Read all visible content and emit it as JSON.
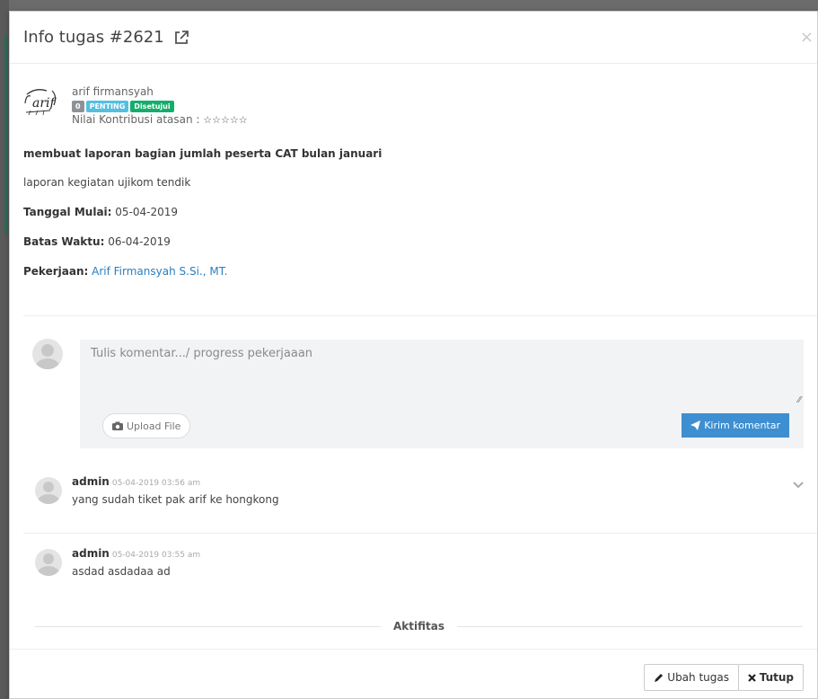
{
  "modal": {
    "title": "Info tugas #2621",
    "close_symbol": "×"
  },
  "author": {
    "name": "arif firmansyah",
    "signature_text": "arif",
    "badge_count": "0",
    "badge_priority": "PENTING",
    "badge_status": "Disetujui",
    "rating_label": "Nilai Kontribusi atasan :",
    "rating_stars": "☆☆☆☆☆"
  },
  "task": {
    "title": "membuat laporan bagian jumlah peserta CAT bulan januari",
    "description": "laporan kegiatan ujikom tendik",
    "start_label": "Tanggal Mulai:",
    "start_value": "05-04-2019",
    "deadline_label": "Batas Waktu:",
    "deadline_value": "06-04-2019",
    "assignee_label": "Pekerjaan:",
    "assignee_value": "Arif Firmansyah S.Si., MT."
  },
  "comment_form": {
    "placeholder": "Tulis komentar.../ progress pekerjaaan",
    "upload_label": "Upload File",
    "send_label": "Kirim komentar"
  },
  "comments": [
    {
      "author": "admin",
      "time": "05-04-2019 03:56 am",
      "text": "yang sudah tiket pak arif ke hongkong"
    },
    {
      "author": "admin",
      "time": "05-04-2019 03:55 am",
      "text": "asdad asdadaa ad"
    }
  ],
  "activity_label": "Aktifitas",
  "footer": {
    "edit_label": "Ubah tugas",
    "close_label": "Tutup"
  },
  "colors": {
    "primary": "#3d8fd1",
    "badge_info": "#55bfe0",
    "badge_success": "#13ae6c",
    "link": "#2a7ec0"
  }
}
